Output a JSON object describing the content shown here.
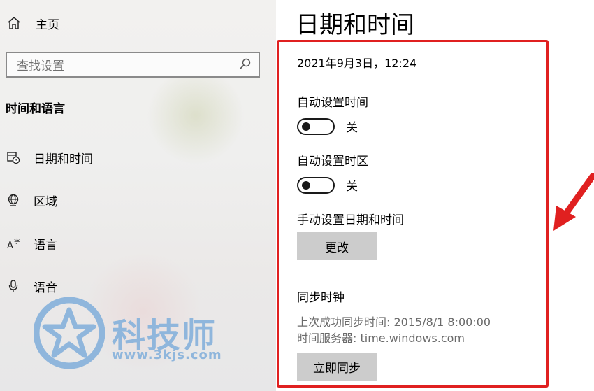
{
  "sidebar": {
    "home_label": "主页",
    "search_placeholder": "查找设置",
    "section_title": "时间和语言",
    "items": [
      {
        "label": "日期和时间",
        "icon": "calendar-clock-icon"
      },
      {
        "label": "区域",
        "icon": "globe-icon"
      },
      {
        "label": "语言",
        "icon": "language-icon"
      },
      {
        "label": "语音",
        "icon": "microphone-icon"
      }
    ]
  },
  "main": {
    "title": "日期和时间",
    "current_datetime": "2021年9月3日，12:24",
    "auto_time": {
      "label": "自动设置时间",
      "state": "关",
      "on": false
    },
    "auto_timezone": {
      "label": "自动设置时区",
      "state": "关",
      "on": false
    },
    "manual": {
      "label": "手动设置日期和时间",
      "button": "更改"
    },
    "sync": {
      "title": "同步时钟",
      "last_sync": "上次成功同步时间: 2015/8/1 8:00:00",
      "server": "时间服务器: time.windows.com",
      "button": "立即同步"
    }
  },
  "watermark": {
    "name": "科技师",
    "url": "www.3kjs.com"
  },
  "colors": {
    "highlight": "#e02020",
    "button_bg": "#cccccc",
    "watermark": "#8fb6dc"
  }
}
